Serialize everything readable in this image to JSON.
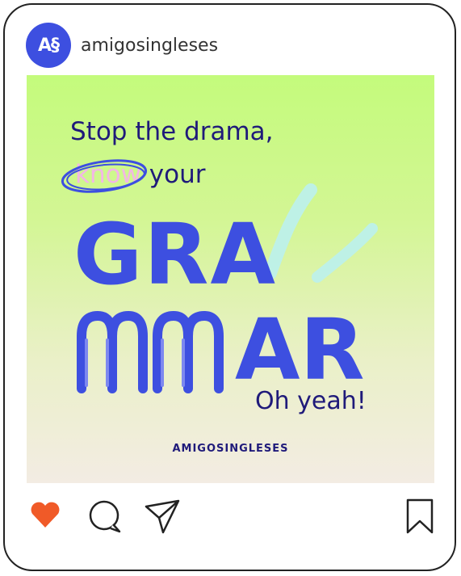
{
  "header": {
    "avatar_text": "A§",
    "username": "amigosingleses"
  },
  "post": {
    "line1": "Stop the drama,",
    "line2_highlight": "know",
    "line2_rest": " your",
    "big_line1": "GRA",
    "big_line2_letters": "AR",
    "tagline": "Oh yeah!",
    "brand": "AMIGOSINGLESES"
  },
  "colors": {
    "accent": "#3d4fe0",
    "navy": "#1f1a7a",
    "pink": "#f3b6e6",
    "like": "#f05a28"
  },
  "icons": [
    "heart-icon",
    "comment-icon",
    "share-icon",
    "bookmark-icon"
  ]
}
